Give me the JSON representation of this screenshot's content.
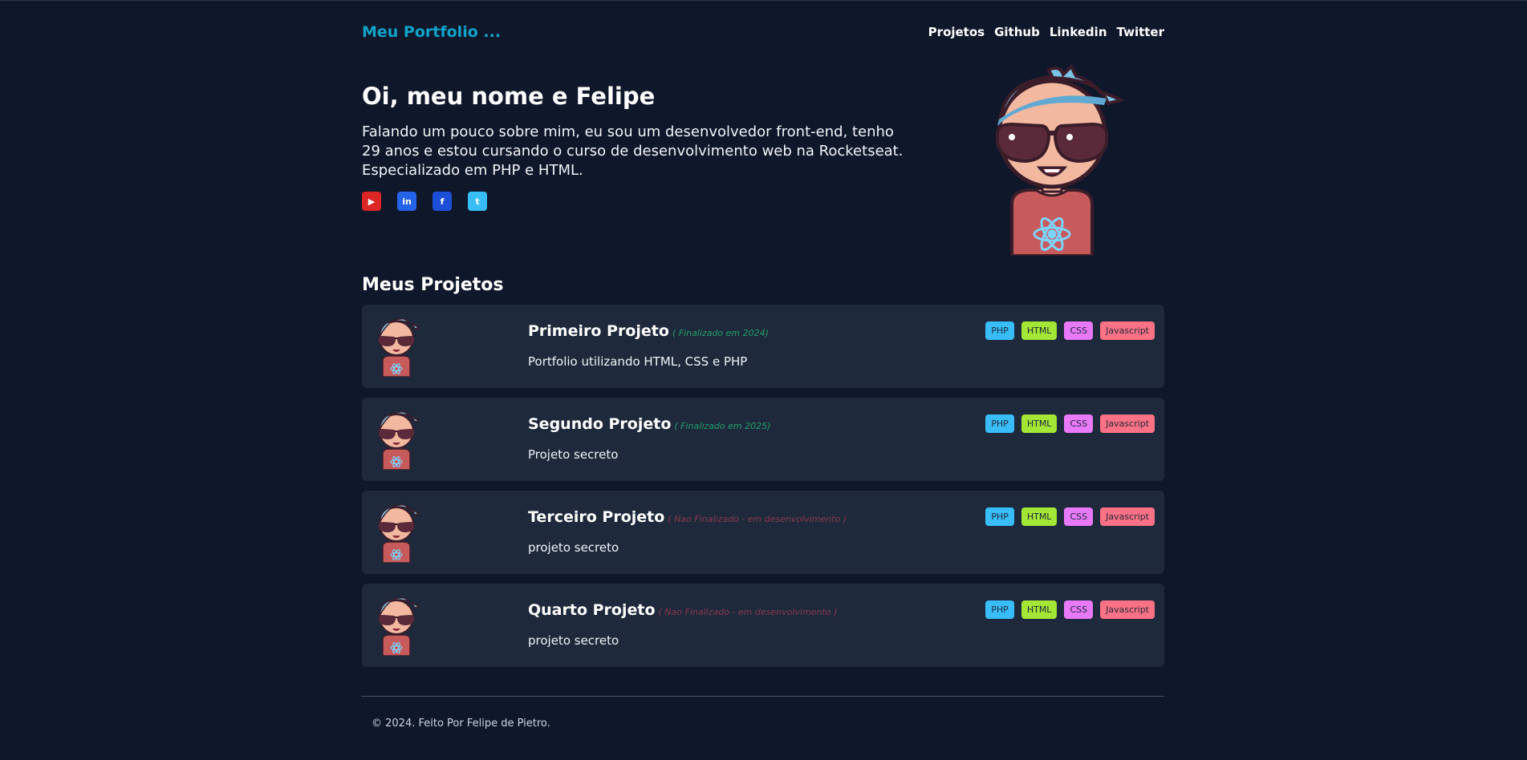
{
  "header": {
    "brand": "Meu Portfolio ...",
    "nav": [
      "Projetos",
      "Github",
      "Linkedin",
      "Twitter"
    ]
  },
  "hero": {
    "title": "Oi, meu nome e Felipe",
    "text": "Falando um pouco sobre mim, eu sou um desenvolvedor front-end, tenho 29 anos e estou cursando o curso de desenvolvimento web na Rocketseat. Especializado em PHP e HTML.",
    "socials": [
      {
        "name": "youtube-icon",
        "glyph": "▶",
        "color": "#dc2626"
      },
      {
        "name": "linkedin-icon",
        "glyph": "in",
        "color": "#2563eb"
      },
      {
        "name": "facebook-icon",
        "glyph": "f",
        "color": "#1d4ed8"
      },
      {
        "name": "twitter-icon",
        "glyph": "t",
        "color": "#38bdf8"
      }
    ]
  },
  "projects": {
    "heading": "Meus Projetos",
    "tags": [
      {
        "label": "PHP",
        "color": "#38bdf8"
      },
      {
        "label": "HTML",
        "color": "#a3e635"
      },
      {
        "label": "CSS",
        "color": "#e879f9"
      },
      {
        "label": "Javascript",
        "color": "#fb7185"
      }
    ],
    "items": [
      {
        "title": "Primeiro Projeto",
        "status": "( Finalizado em 2024)",
        "finished": true,
        "desc": "Portfolio utilizando HTML, CSS e PHP"
      },
      {
        "title": "Segundo Projeto",
        "status": "( Finalizado em 2025)",
        "finished": true,
        "desc": "Projeto secreto"
      },
      {
        "title": "Terceiro Projeto",
        "status": "( Nao Finalizado - em desenvolvimento )",
        "finished": false,
        "desc": "projeto secreto"
      },
      {
        "title": "Quarto Projeto",
        "status": "( Nao Finalizado - em desenvolvimento )",
        "finished": false,
        "desc": "projeto secreto"
      }
    ]
  },
  "footer": {
    "text": "© 2024. Feito Por Felipe de Pietro."
  },
  "colors": {
    "background": "#0f172a",
    "card": "#1e293b",
    "brand": "#0ea5c9"
  }
}
